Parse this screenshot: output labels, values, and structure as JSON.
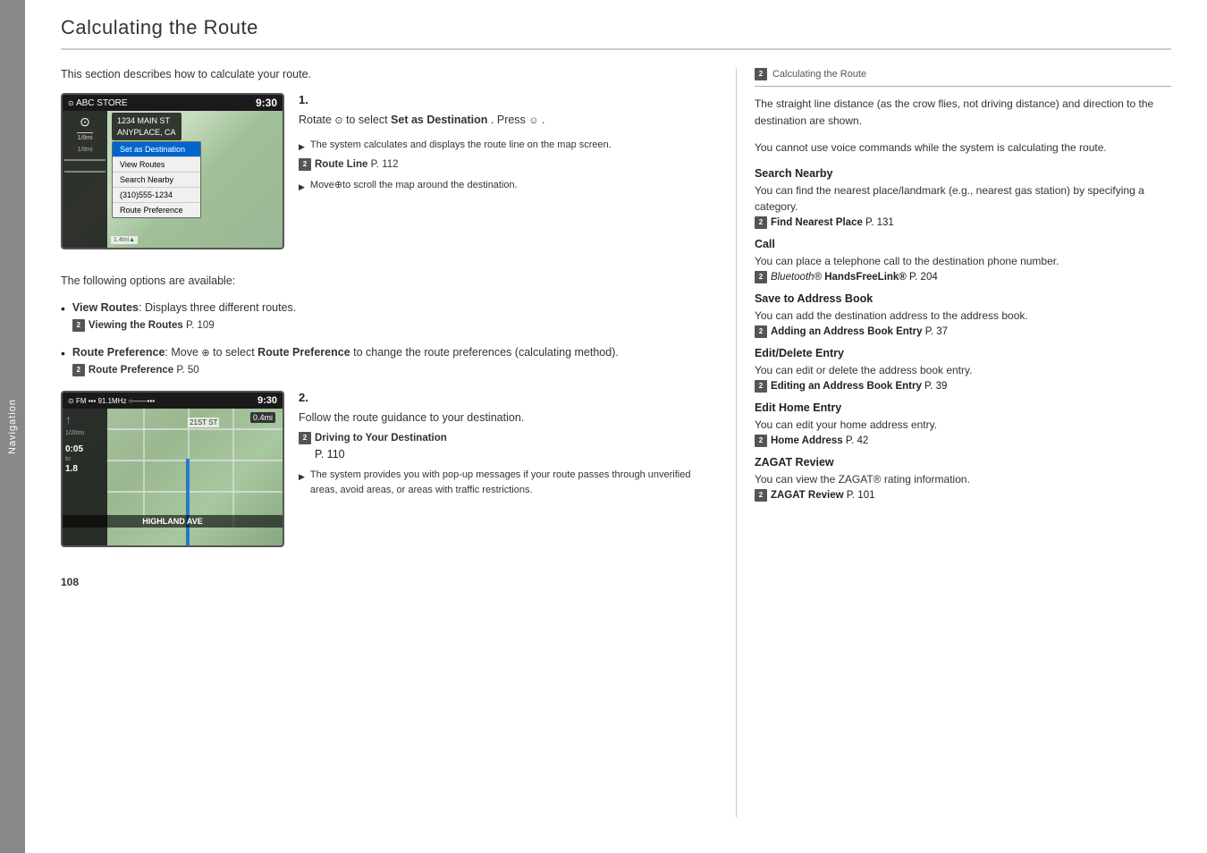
{
  "page": {
    "title": "Calculating the Route",
    "page_number": "108",
    "sidebar_label": "Navigation"
  },
  "intro": {
    "text": "This section describes how to calculate your route."
  },
  "step1": {
    "number": "1.",
    "instruction": "Rotate ",
    "instruction_icon": "⊙",
    "instruction_end": " to select ",
    "bold_text": "Set as Destination",
    "press_text": ". Press ",
    "press_icon": "☺",
    "press_end": ".",
    "arrow1_text": "The system calculates and displays the route line on the map screen.",
    "ref1_bold": "Route Line",
    "ref1_text": " P. 112",
    "arrow2_text": "Move ",
    "arrow2_icon": "⊕",
    "arrow2_end": " to scroll the map around the destination."
  },
  "step2": {
    "number": "2.",
    "instruction": "Follow the route guidance to your destination.",
    "ref1_bold": "Driving to Your Destination",
    "ref1_text": "P. 110",
    "arrow1_text": "The system provides you with pop-up messages if your route passes through unverified areas, avoid areas, or areas with traffic restrictions."
  },
  "bullets": [
    {
      "bold": "View Routes",
      "text": ": Displays three different routes.",
      "ref_bold": "Viewing the Routes",
      "ref_text": " P. 109"
    },
    {
      "bold": "Route Preference",
      "text": ": Move ",
      "icon": "⊕",
      "text2": " to select ",
      "bold2": "Route Preference",
      "text3": " to change the route preferences (calculating method).",
      "ref_bold": "Route Preference",
      "ref_text": " P. 50"
    }
  ],
  "sidebar": {
    "header": "Calculating the Route",
    "note1": "The straight line distance (as the crow flies, not driving distance) and direction to the destination are shown.",
    "note2": "You cannot use voice commands while the system is calculating the route.",
    "sections": [
      {
        "title": "Search Nearby",
        "body": "You can find the nearest place/landmark (e.g., nearest gas station) by specifying a category.",
        "ref_bold": "Find Nearest Place",
        "ref_text": " P. 131"
      },
      {
        "title": "Call",
        "body": "You can place a telephone call to the destination phone number.",
        "ref_italic": "Bluetooth®",
        "ref_bold": " HandsFreeLink®",
        "ref_text": " P. 204"
      },
      {
        "title": "Save to Address Book",
        "body": "You can add the destination address to the address book.",
        "ref_bold": "Adding an Address Book Entry",
        "ref_text": " P. 37"
      },
      {
        "title": "Edit/Delete Entry",
        "body": "You can edit or delete the address book entry.",
        "ref_bold": "Editing an Address Book Entry",
        "ref_text": " P. 39"
      },
      {
        "title": "Edit Home Entry",
        "body": "You can edit your home address entry.",
        "ref_bold": "Home Address",
        "ref_text": " P. 42"
      },
      {
        "title": "ZAGAT Review",
        "body": "You can view the ZAGAT® rating information.",
        "ref_bold": "ZAGAT Review",
        "ref_text": " P. 101"
      }
    ]
  },
  "screen1": {
    "store": "ABC STORE",
    "time": "9:30",
    "address1": "1234 MAIN ST",
    "address2": "ANYPLACE, CA",
    "menu": [
      {
        "label": "Set as Destination",
        "highlight": true
      },
      {
        "label": "View Routes",
        "highlight": false
      },
      {
        "label": "Search Nearby",
        "highlight": false
      },
      {
        "label": "(310)555-1234",
        "highlight": false
      },
      {
        "label": "Route Preference",
        "highlight": false
      }
    ],
    "scale": "1/8mi"
  },
  "screen2": {
    "fm": "FM",
    "freq": "91.1MHz",
    "time": "9:30",
    "street": "21ST ST",
    "road_label": "HIGHLAND AVE",
    "dist": "0.4mi",
    "time_remaining": "0:05",
    "to_dest": "to",
    "miles": "1.8",
    "scale": "1/20mi"
  }
}
